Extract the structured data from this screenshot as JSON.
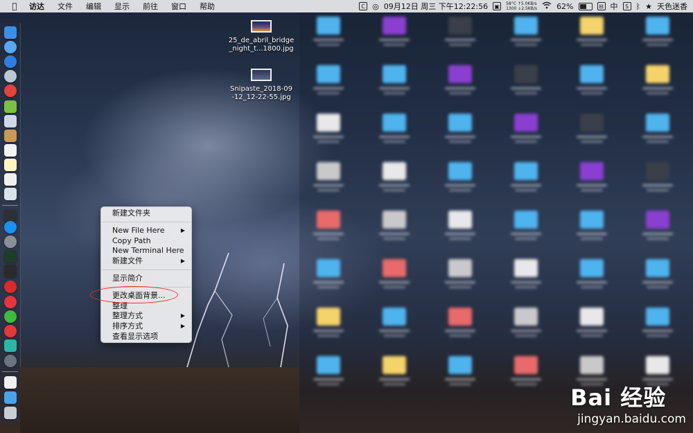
{
  "menubar": {
    "apple_icon": "apple-icon",
    "items": [
      "访达",
      "文件",
      "编辑",
      "显示",
      "前往",
      "窗口",
      "帮助"
    ],
    "status": {
      "datetime": "09月12日 周三 下午12:22:56",
      "temp": "58°C",
      "rpm": "1300",
      "net_up": "5.0KB/s",
      "net_down": "2.5KB/s",
      "battery": "62%",
      "battery_level": 0.62,
      "input_method": "中",
      "user": "天色迷香"
    }
  },
  "desktop": {
    "files": [
      {
        "name_line1": "25_de_abril_bridge",
        "name_line2": "_night_t...1800.jpg"
      },
      {
        "name_line1": "Snipaste_2018-09",
        "name_line2": "-12_12-22-55.jpg"
      }
    ]
  },
  "context_menu": {
    "new_folder": "新建文件夹",
    "new_file_here": "New File Here",
    "copy_path": "Copy Path",
    "new_terminal_here": "New Terminal Here",
    "new_file": "新建文件",
    "get_info": "显示简介",
    "change_background": "更改桌面背景...",
    "clean_up": "整理",
    "clean_up_by": "整理方式",
    "sort_by": "排序方式",
    "show_view_options": "查看显示选项"
  },
  "watermark": {
    "logo": "Bai 经验",
    "url": "jingyan.baidu.com"
  }
}
